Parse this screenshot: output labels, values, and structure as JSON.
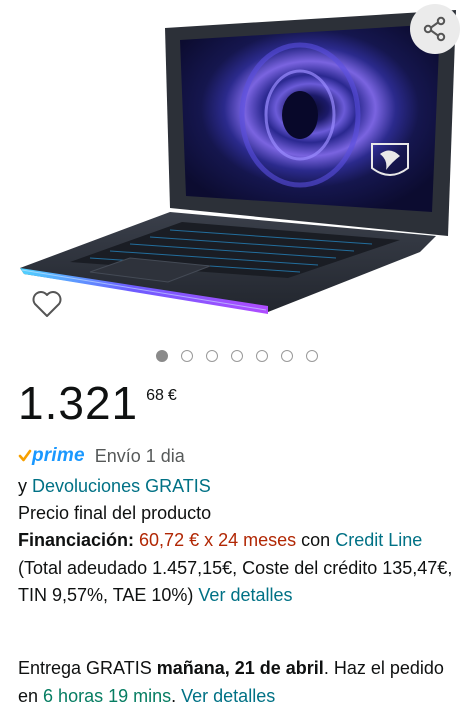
{
  "image": {
    "alt": "MSI laptop"
  },
  "actions": {
    "share_icon": "share-icon",
    "wishlist_icon": "heart-icon"
  },
  "carousel": {
    "total": 7,
    "active_index": 0
  },
  "price": {
    "whole": "1.321",
    "fraction": "68",
    "currency": "€"
  },
  "prime": {
    "logo_text": "prime",
    "shipping": "Envío 1 dia"
  },
  "returns": {
    "prefix": "y",
    "link": "Devoluciones GRATIS"
  },
  "final_price_note": "Precio final del producto",
  "financing": {
    "label": "Financiación:",
    "amount": "60,72 € x 24 meses",
    "with": "con",
    "provider": "Credit Line",
    "details": "(Total adeudado 1.457,15€, Coste del crédito 135,47€, TIN 9,57%, TAE 10%)",
    "details_link": "Ver detalles"
  },
  "delivery": {
    "prefix": "Entrega GRATIS",
    "date": "mañana, 21 de abril",
    "order_text": ". Haz el pedido en",
    "countdown": "6 horas 19 mins",
    "link": "Ver detalles"
  },
  "colors": {
    "link": "#007185",
    "price_red": "#b12704",
    "prime_blue": "#1a98ff",
    "prime_check": "#f7a000",
    "countdown_green": "#067d62"
  }
}
